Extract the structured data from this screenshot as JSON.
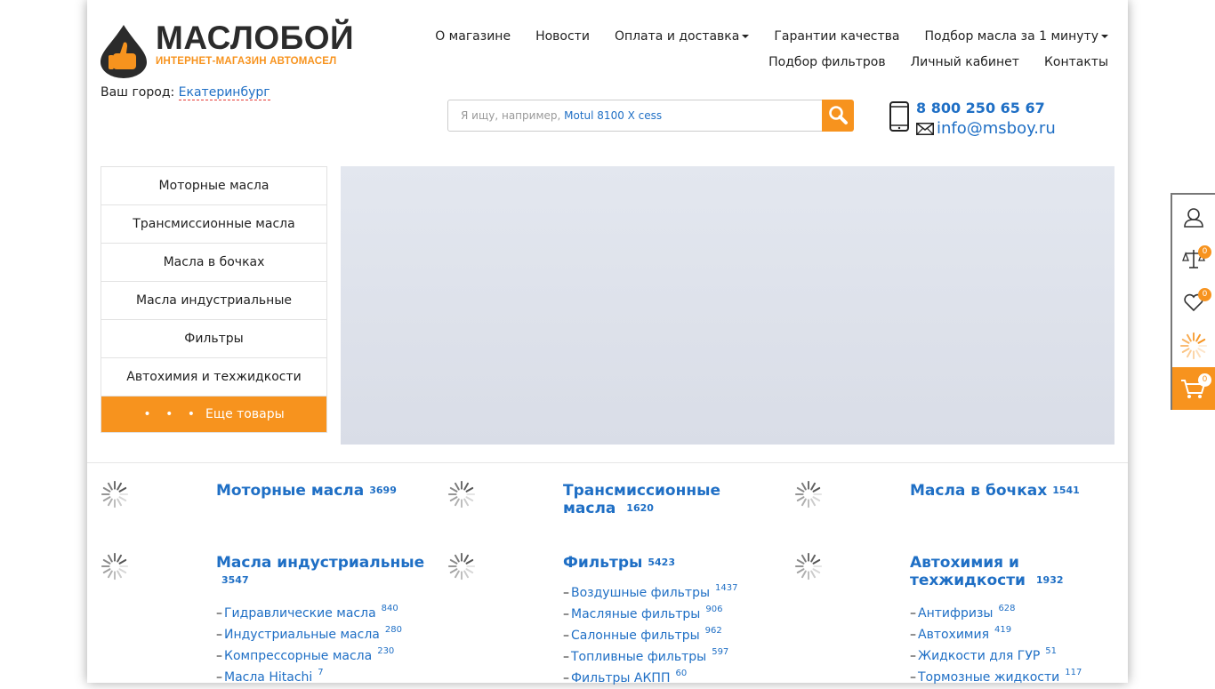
{
  "logo": {
    "name": "МАСЛОБОЙ",
    "tagline": "ИНТЕРНЕТ-МАГАЗИН АВТОМАСЕЛ"
  },
  "city": {
    "label": "Ваш город:",
    "value": "Екатеринбург"
  },
  "nav": {
    "row1": [
      {
        "label": "О магазине",
        "dropdown": false
      },
      {
        "label": "Новости",
        "dropdown": false
      },
      {
        "label": "Оплата и доставка",
        "dropdown": true
      },
      {
        "label": "Гарантии качества",
        "dropdown": false
      },
      {
        "label": "Подбор масла за 1 минуту",
        "dropdown": true
      }
    ],
    "row2": [
      {
        "label": "Подбор фильтров"
      },
      {
        "label": "Личный кабинет"
      },
      {
        "label": "Контакты"
      }
    ]
  },
  "search": {
    "placeholder_prefix": "Я ищу, например, ",
    "placeholder_example": "Motul 8100 X cess"
  },
  "contacts": {
    "phone": "8 800 250 65 67",
    "email": "info@msboy.ru"
  },
  "sidebar": {
    "items": [
      "Моторные масла",
      "Трансмиссионные масла",
      "Масла в бочках",
      "Масла индустриальные",
      "Фильтры",
      "Автохимия и техжидкости"
    ],
    "more_dots": "• • •",
    "more_label": "Еще товары"
  },
  "categories": [
    {
      "title": "Моторные масла",
      "count": "3699",
      "subs": []
    },
    {
      "title": "Трансмиссионные масла",
      "count": "1620",
      "subs": []
    },
    {
      "title": "Масла в бочках",
      "count": "1541",
      "subs": []
    },
    {
      "title": "Масла индустриальные",
      "count": "3547",
      "subs": [
        {
          "label": "Гидравлические масла",
          "n": "840"
        },
        {
          "label": "Индустриальные масла",
          "n": "280"
        },
        {
          "label": "Компрессорные масла",
          "n": "230"
        },
        {
          "label": "Масла Hitachi",
          "n": "7"
        }
      ]
    },
    {
      "title": "Фильтры",
      "count": "5423",
      "subs": [
        {
          "label": "Воздушные фильтры",
          "n": "1437"
        },
        {
          "label": "Масляные фильтры",
          "n": "906"
        },
        {
          "label": "Салонные фильтры",
          "n": "962"
        },
        {
          "label": "Топливные фильтры",
          "n": "597"
        },
        {
          "label": "Фильтры АКПП",
          "n": "60"
        }
      ]
    },
    {
      "title": "Автохимия и техжидкости",
      "count": "1932",
      "subs": [
        {
          "label": "Антифризы",
          "n": "628"
        },
        {
          "label": "Автохимия",
          "n": "419"
        },
        {
          "label": "Жидкости для ГУР",
          "n": "51"
        },
        {
          "label": "Тормозные жидкости",
          "n": "117"
        }
      ]
    }
  ],
  "side_panel": {
    "compare_count": "0",
    "favorites_count": "0",
    "cart_count": "0"
  },
  "colors": {
    "accent": "#f7931e",
    "link": "#1f6fc5"
  },
  "icons": [
    "user-icon",
    "scales-icon",
    "heart-icon",
    "spinner-icon",
    "cart-icon",
    "search-icon",
    "phone-icon",
    "mail-icon"
  ]
}
